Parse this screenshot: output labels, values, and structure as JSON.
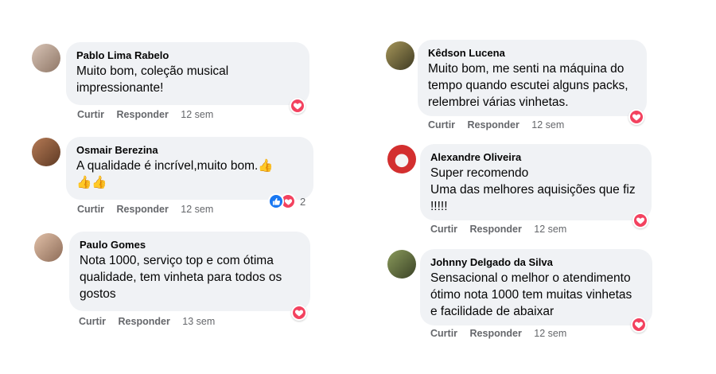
{
  "comments": [
    {
      "author": "Pablo Lima Rabelo",
      "text": "Muito bom, coleção musical\nimpressionante!",
      "like": "Curtir",
      "reply": "Responder",
      "time": "12 sem",
      "avatar_color": "#b89a86"
    },
    {
      "author": "Osmair Berezina",
      "text": "A qualidade é incrível,muito bom.👍\n👍👍",
      "like": "Curtir",
      "reply": "Responder",
      "time": "12 sem",
      "reaction_count": "2",
      "avatar_color": "#8a5a3c"
    },
    {
      "author": "Paulo Gomes",
      "text": "Nota 1000, serviço top e com ótima\nqualidade, tem vinheta para todos os\ngostos",
      "like": "Curtir",
      "reply": "Responder",
      "time": "13 sem",
      "avatar_color": "#c79d82"
    },
    {
      "author": "Kêdson Lucena",
      "text": "Muito bom, me senti na máquina do\ntempo quando escutei alguns packs,\nrelembrei várias vinhetas.",
      "like": "Curtir",
      "reply": "Responder",
      "time": "12 sem",
      "avatar_color": "#7a6a3a"
    },
    {
      "author": "Alexandre Oliveira",
      "text": "Super recomendo\nUma das melhores aquisições que fiz\n!!!!!",
      "like": "Curtir",
      "reply": "Responder",
      "time": "12 sem",
      "avatar_color": "#c62828"
    },
    {
      "author": "Johnny Delgado da Silva",
      "text": "Sensacional o melhor o atendimento\nótimo nota 1000 tem muitas vinhetas\ne facilidade de abaixar",
      "like": "Curtir",
      "reply": "Responder",
      "time": "12 sem",
      "avatar_color": "#5d6b3f"
    }
  ],
  "colors": {
    "bubble": "#f0f2f5",
    "love": "#f3425f",
    "like": "#1877f2",
    "meta": "#65676b"
  },
  "icons": {
    "love": "heart-icon",
    "like": "thumbs-up-icon"
  }
}
